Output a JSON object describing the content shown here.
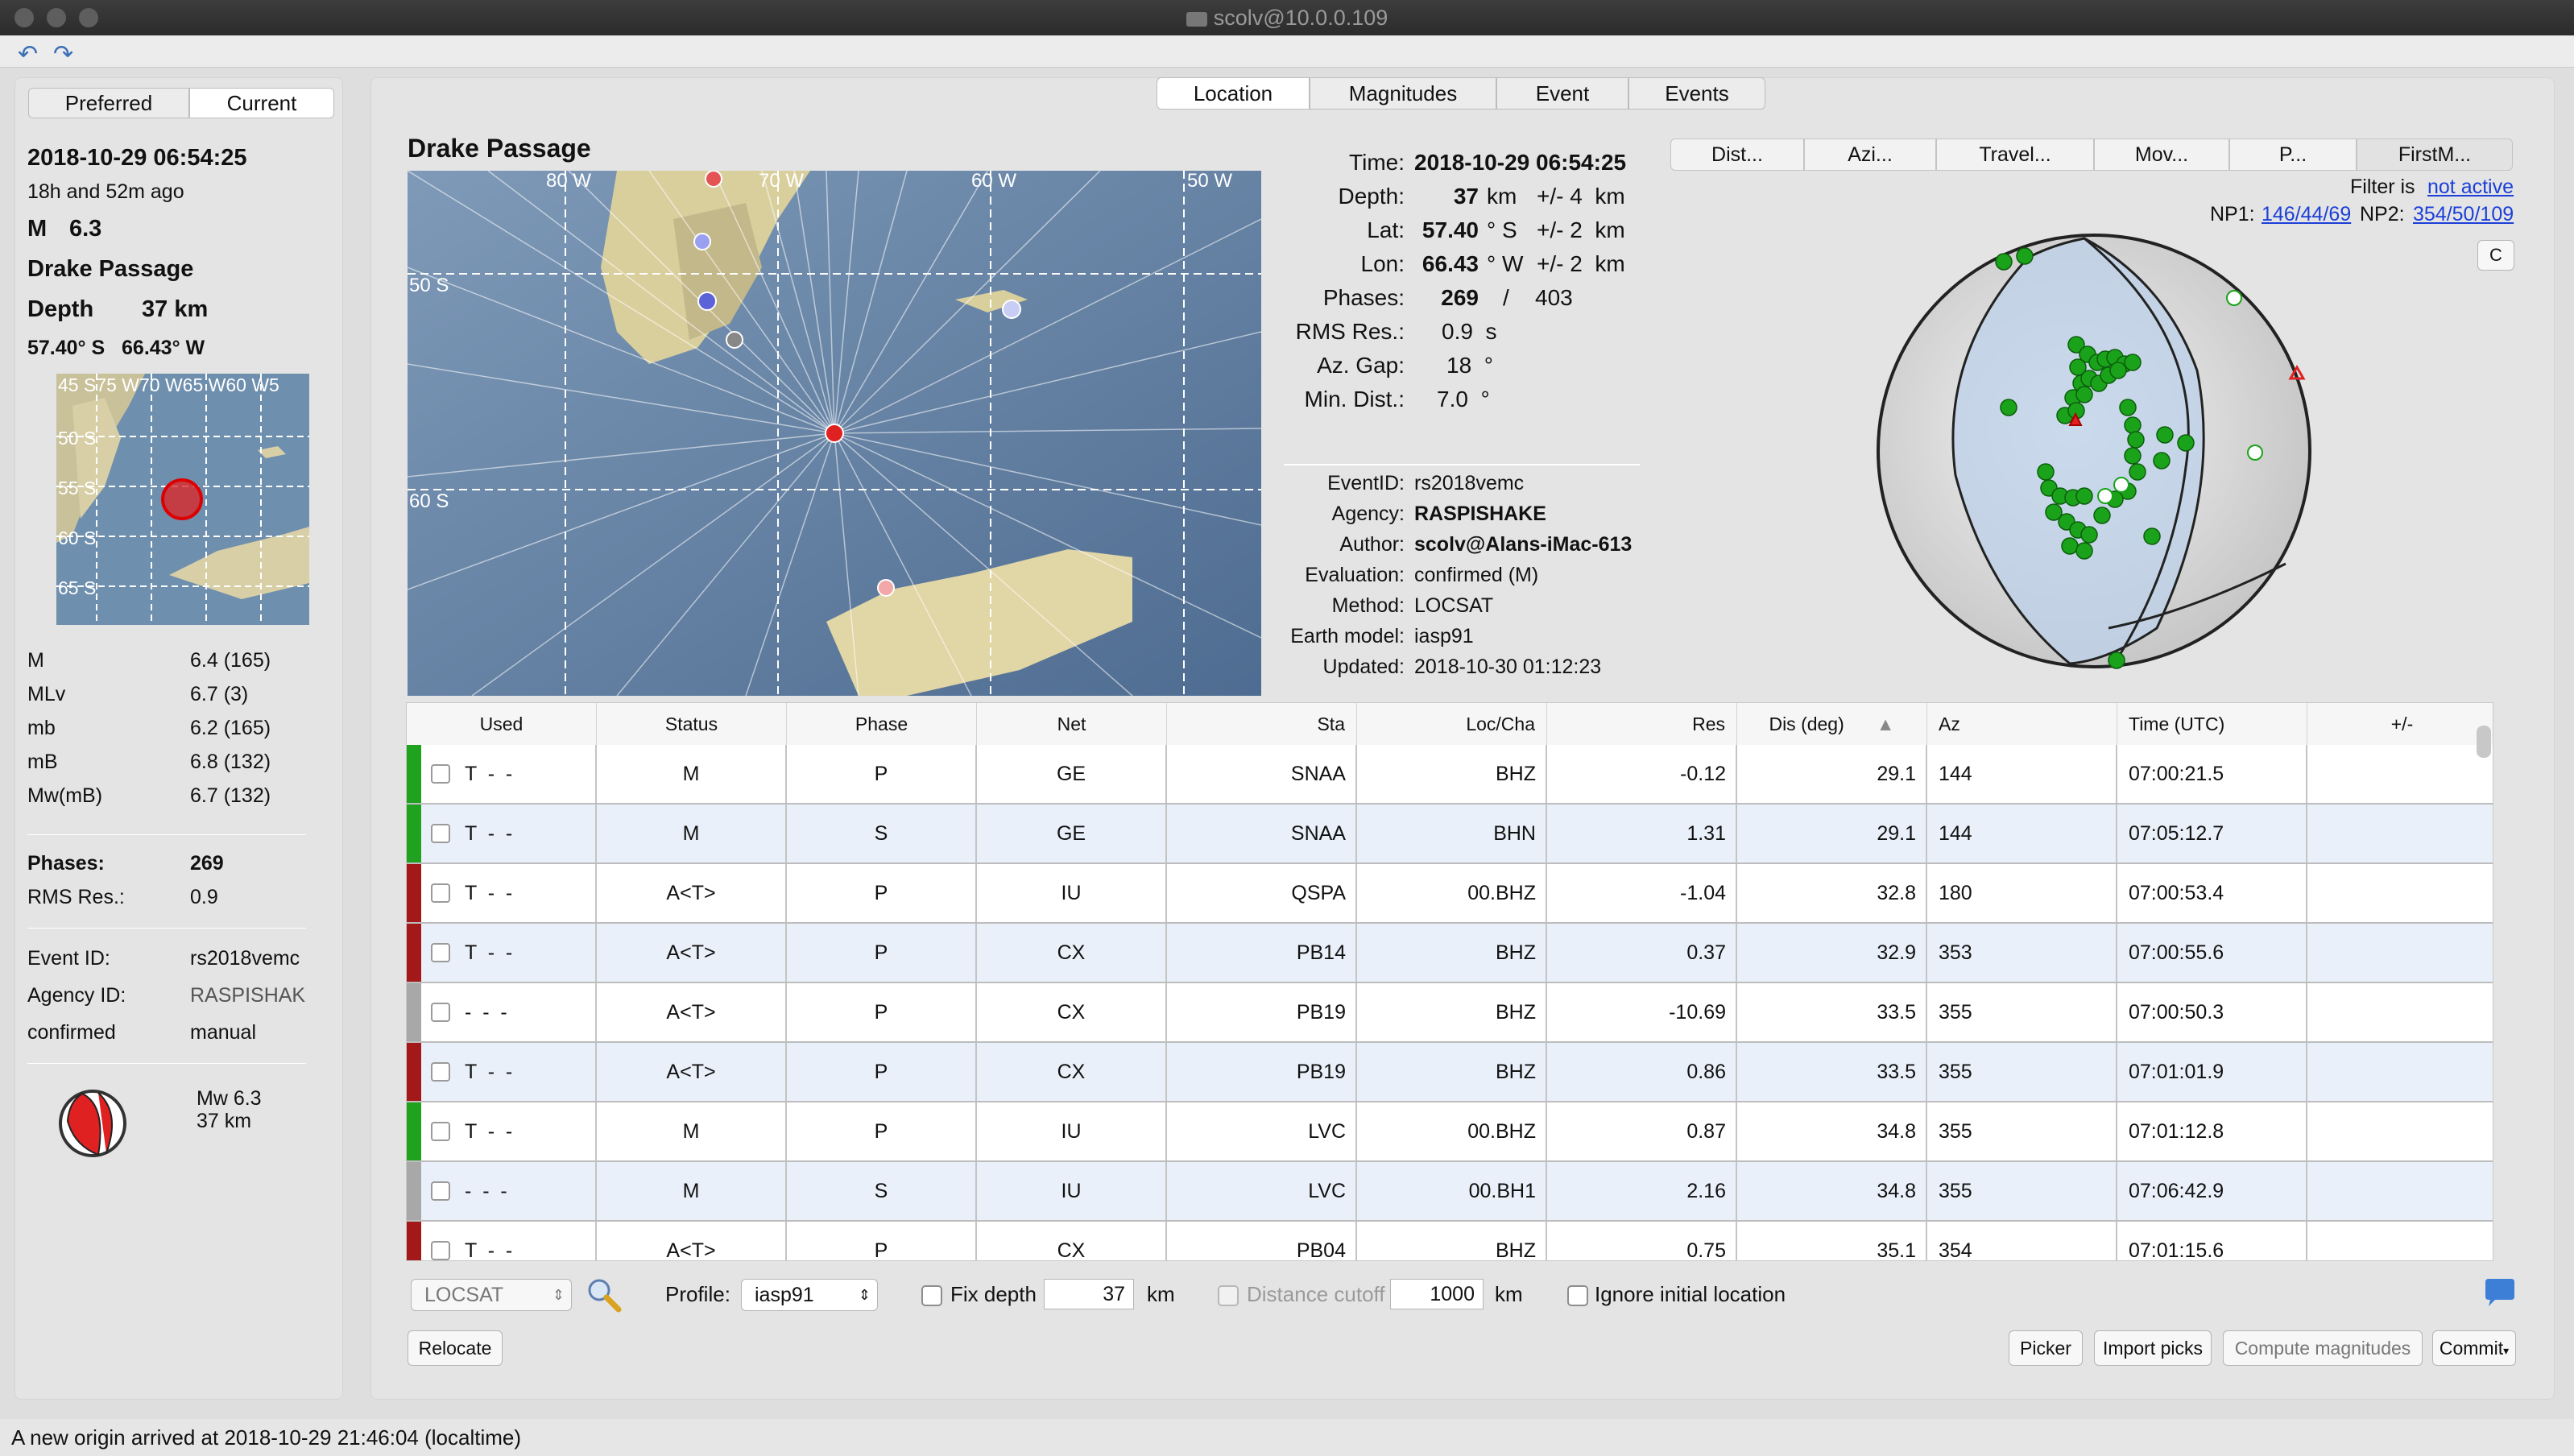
{
  "window": {
    "title": "scolv@10.0.0.109"
  },
  "left": {
    "tabs": [
      "Preferred",
      "Current"
    ],
    "datetime": "2018-10-29 06:54:25",
    "ago": "18h and 52m ago",
    "mag_label": "M",
    "mag_value": "6.3",
    "region": "Drake Passage",
    "depth_label": "Depth",
    "depth_value": "37 km",
    "latlon": "57.40° S   66.43° W",
    "minimap_labels": {
      "top": "45 S75 W70 W65 W60 W5",
      "lat": [
        "50 S",
        "55 S",
        "60 S",
        "65 S"
      ]
    },
    "mags": [
      {
        "type": "M",
        "value": "6.4 (165)"
      },
      {
        "type": "MLv",
        "value": "6.7 (3)"
      },
      {
        "type": "mb",
        "value": "6.2 (165)"
      },
      {
        "type": "mB",
        "value": "6.8 (132)"
      },
      {
        "type": "Mw(mB)",
        "value": "6.7 (132)"
      }
    ],
    "phases_label": "Phases:",
    "phases_value": "269",
    "rms_label": "RMS Res.:",
    "rms_value": "0.9",
    "eventid_label": "Event ID:",
    "eventid_value": "rs2018vemc",
    "agency_label": "Agency ID:",
    "agency_value": "RASPISHAK",
    "status_label": "confirmed",
    "status_value": "manual",
    "fm_mw": "Mw 6.3",
    "fm_depth": "37 km"
  },
  "tabs": [
    "Location",
    "Magnitudes",
    "Event",
    "Events"
  ],
  "map": {
    "title": "Drake Passage",
    "lon_labels": [
      "80 W",
      "70 W",
      "60 W",
      "50 W"
    ],
    "lat_labels": [
      "50 S",
      "60 S"
    ]
  },
  "origin": {
    "time_label": "Time:",
    "time": "2018-10-29 06:54:25",
    "depth_label": "Depth:",
    "depth": "37",
    "depth_unit": "km",
    "depth_err": "+/- 4  km",
    "lat_label": "Lat:",
    "lat": "57.40",
    "lat_unit": "° S",
    "lat_err": "+/- 2  km",
    "lon_label": "Lon:",
    "lon": "66.43",
    "lon_unit": "° W",
    "lon_err": "+/- 2  km",
    "phases_label": "Phases:",
    "phases": "269",
    "phases_sep": "/",
    "phases_total": "403",
    "rms_label": "RMS Res.:",
    "rms": "0.9  s",
    "gap_label": "Az. Gap:",
    "gap": "18  °",
    "mindist_label": "Min. Dist.:",
    "mindist": "7.0  °",
    "eventid_label": "EventID:",
    "eventid": "rs2018vemc",
    "agency_label": "Agency:",
    "agency": "RASPISHAKE",
    "author_label": "Author:",
    "author": "scolv@Alans-iMac-613",
    "eval_label": "Evaluation:",
    "eval": "confirmed (M)",
    "method_label": "Method:",
    "method": "LOCSAT",
    "earth_label": "Earth model:",
    "earth": "iasp91",
    "updated_label": "Updated:",
    "updated": "2018-10-30 01:12:23"
  },
  "fm": {
    "tabs": [
      "Dist...",
      "Azi...",
      "Travel...",
      "Mov...",
      "P...",
      "FirstM..."
    ],
    "filter_label": "Filter is",
    "filter_link": "not active",
    "np1_label": "NP1:",
    "np1": "146/44/69",
    "np2_label": "NP2:",
    "np2": "354/50/109",
    "c_button": "C"
  },
  "table": {
    "headers": [
      "Used",
      "Status",
      "Phase",
      "Net",
      "Sta",
      "Loc/Cha",
      "Res",
      "Dis (deg)",
      "Az",
      "Time (UTC)",
      "+/-"
    ],
    "rows": [
      {
        "bar": "#1fa31f",
        "used": "T  -  -",
        "status": "M",
        "phase": "P",
        "net": "GE",
        "sta": "SNAA",
        "loc": "BHZ",
        "res": "-0.12",
        "dis": "29.1",
        "az": "144",
        "time": "07:00:21.5"
      },
      {
        "bar": "#1fa31f",
        "used": "T  -  -",
        "status": "M",
        "phase": "S",
        "net": "GE",
        "sta": "SNAA",
        "loc": "BHN",
        "res": "1.31",
        "dis": "29.1",
        "az": "144",
        "time": "07:05:12.7"
      },
      {
        "bar": "#a31818",
        "used": "T  -  -",
        "status": "A<T>",
        "phase": "P",
        "net": "IU",
        "sta": "QSPA",
        "loc": "00.BHZ",
        "res": "-1.04",
        "dis": "32.8",
        "az": "180",
        "time": "07:00:53.4"
      },
      {
        "bar": "#a31818",
        "used": "T  -  -",
        "status": "A<T>",
        "phase": "P",
        "net": "CX",
        "sta": "PB14",
        "loc": "BHZ",
        "res": "0.37",
        "dis": "32.9",
        "az": "353",
        "time": "07:00:55.6"
      },
      {
        "bar": "#a8a8a8",
        "used": "-  -  -",
        "status": "A<T>",
        "phase": "P",
        "net": "CX",
        "sta": "PB19",
        "loc": "BHZ",
        "res": "-10.69",
        "dis": "33.5",
        "az": "355",
        "time": "07:00:50.3"
      },
      {
        "bar": "#a31818",
        "used": "T  -  -",
        "status": "A<T>",
        "phase": "P",
        "net": "CX",
        "sta": "PB19",
        "loc": "BHZ",
        "res": "0.86",
        "dis": "33.5",
        "az": "355",
        "time": "07:01:01.9"
      },
      {
        "bar": "#1fa31f",
        "used": "T  -  -",
        "status": "M",
        "phase": "P",
        "net": "IU",
        "sta": "LVC",
        "loc": "00.BHZ",
        "res": "0.87",
        "dis": "34.8",
        "az": "355",
        "time": "07:01:12.8"
      },
      {
        "bar": "#a8a8a8",
        "used": "-  -  -",
        "status": "M",
        "phase": "S",
        "net": "IU",
        "sta": "LVC",
        "loc": "00.BH1",
        "res": "2.16",
        "dis": "34.8",
        "az": "355",
        "time": "07:06:42.9"
      },
      {
        "bar": "#a31818",
        "used": "T  -  -",
        "status": "A<T>",
        "phase": "P",
        "net": "CX",
        "sta": "PB04",
        "loc": "BHZ",
        "res": "0.75",
        "dis": "35.1",
        "az": "354",
        "time": "07:01:15.6"
      }
    ]
  },
  "bottom": {
    "locator": "LOCSAT",
    "profile_label": "Profile:",
    "profile": "iasp91",
    "fixdepth_label": "Fix depth",
    "fixdepth": "37",
    "km": "km",
    "cutoff_label": "Distance cutoff",
    "cutoff": "1000",
    "ignore_label": "Ignore initial location",
    "relocate": "Relocate",
    "picker": "Picker",
    "import": "Import picks",
    "compute": "Compute magnitudes",
    "commit": "Commit"
  },
  "status": "A new origin arrived at 2018-10-29 21:46:04 (localtime)"
}
